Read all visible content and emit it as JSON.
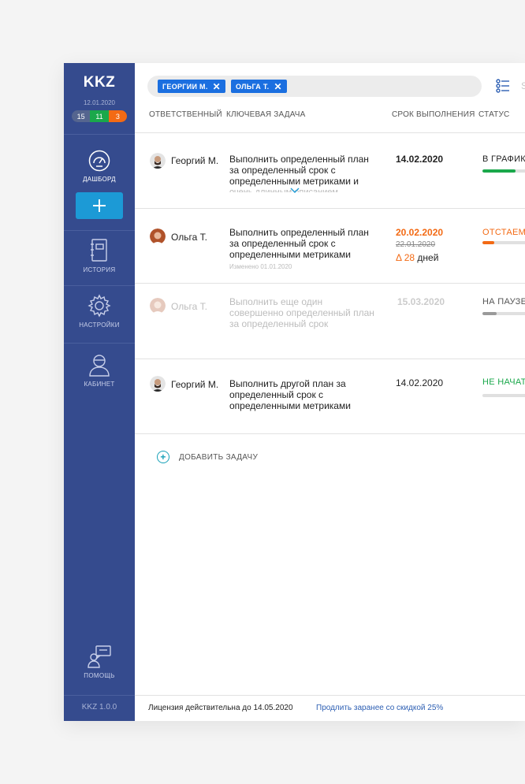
{
  "app": {
    "logo": "KKZ",
    "date": "12.01.2020",
    "counts": [
      "15",
      "11",
      "3"
    ],
    "version": "KKZ 1.0.0"
  },
  "sidebar": {
    "dashboard": "ДАШБОРД",
    "history": "ИСТОРИЯ",
    "settings": "НАСТРОЙКИ",
    "cabinet": "КАБИНЕТ",
    "help": "ПОМОЩЬ"
  },
  "filters": [
    "ГЕОРГИИ М.",
    "ОЛЬГА Т."
  ],
  "search_cut": "S",
  "columns": {
    "owner": "ОТВЕТСТВЕННЫЙ",
    "task": "КЛЮЧЕВАЯ ЗАДАЧА",
    "due": "СРОК ВЫПОЛНЕНИЯ",
    "status": "СТАТУС"
  },
  "rows": [
    {
      "person": "Георгий М.",
      "task": "Выполнить определенный план за определенный срок с определенными метриками и",
      "task_tail": "очень длинным описанием",
      "due": "14.02.2020",
      "status": "В ГРАФИКЕ",
      "status_color": "#222222",
      "progress": 0.7,
      "progress_color": "#1aa84b"
    },
    {
      "person": "Ольга Т.",
      "task": "Выполнить определенный план за определенный срок с определенными метриками",
      "changed": "Изменено  01.01.2020",
      "due": "20.02.2020",
      "due_old": "22.01.2020",
      "delta_prefix": "Δ",
      "delta_days": "28",
      "delta_suffix": "дней",
      "status": "ОТСТАЕМ",
      "status_color": "#f36a14",
      "progress": 0.25,
      "progress_color": "#f36a14"
    },
    {
      "person": "Ольга Т.",
      "task": "Выполнить еще один совершенно определенный план за определенный срок",
      "due": "15.03.2020",
      "status": "НА ПАУЗЕ",
      "status_color": "#555555",
      "progress": 0.3,
      "progress_color": "#9a9a9a"
    },
    {
      "person": "Георгий М.",
      "task": "Выполнить другой план за определенный срок с определенными метриками",
      "due": "14.02.2020",
      "status": "НЕ НАЧАТО",
      "status_color": "#1aa84b",
      "progress": 0,
      "progress_color": "#1aa84b"
    }
  ],
  "add_task": "ДОБАВИТЬ ЗАДАЧУ",
  "footer": {
    "license": "Лицензия действительна до 14.05.2020",
    "renew": "Продлить заранее со скидкой 25%"
  },
  "colors": {
    "sidebar": "#354b8e",
    "accent": "#1c9ad6",
    "chip": "#1b6fe0",
    "orange": "#f36a14",
    "green": "#1aa84b"
  }
}
